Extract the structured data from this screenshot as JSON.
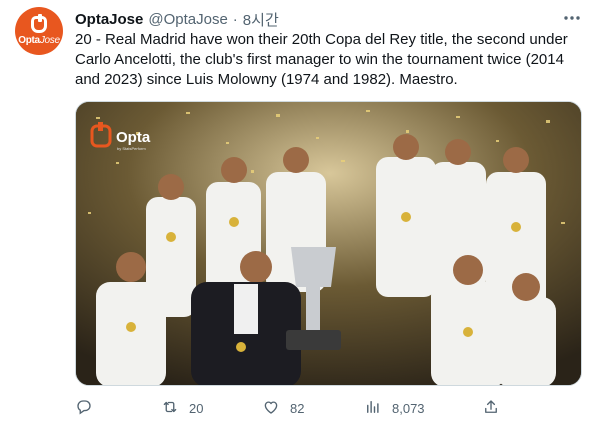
{
  "author": {
    "name": "OptaJose",
    "handle": "@OptaJose",
    "separator": "·",
    "time": "8시간",
    "avatar_logo": "Opta Jose",
    "avatar_color": "#e8571f"
  },
  "tweet": {
    "text": "20 - Real Madrid have won their 20th Copa del Rey title, the second under Carlo Ancelotti, the club's first manager to win the tournament twice (2014 and 2023) since Luis Molowny (1974 and 1982). Maestro."
  },
  "media": {
    "watermark": "Opta",
    "watermark_sub": "by StatsPerform",
    "description_icon": "photo"
  },
  "actions": {
    "reply": {
      "icon": "reply-icon",
      "count": ""
    },
    "retweet": {
      "icon": "retweet-icon",
      "count": "20"
    },
    "like": {
      "icon": "heart-icon",
      "count": "82"
    },
    "views": {
      "icon": "views-icon",
      "count": "8,073"
    },
    "share": {
      "icon": "share-icon",
      "count": ""
    }
  },
  "colors": {
    "text": "#0f1419",
    "muted": "#536471",
    "border": "#cfd9de"
  }
}
